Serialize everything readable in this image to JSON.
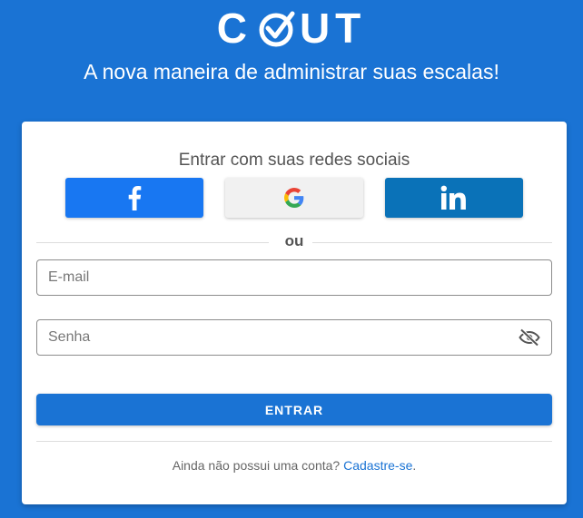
{
  "header": {
    "logo_left": "C",
    "logo_right": "UT",
    "tagline": "A nova maneira de administrar suas escalas!"
  },
  "login": {
    "social_title": "Entrar com suas redes sociais",
    "social_buttons": [
      {
        "name": "facebook",
        "icon": "facebook-icon",
        "color": "#1877f2"
      },
      {
        "name": "google",
        "icon": "google-icon",
        "color": "#f1f1f1"
      },
      {
        "name": "linkedin",
        "icon": "linkedin-icon",
        "color": "#0a72b8"
      }
    ],
    "divider_text": "ou",
    "email": {
      "placeholder": "E-mail",
      "value": ""
    },
    "password": {
      "placeholder": "Senha",
      "value": ""
    },
    "submit_label": "ENTRAR",
    "signup_prompt": "Ainda não possui uma conta?",
    "signup_link": "Cadastre-se",
    "signup_suffix": "."
  },
  "colors": {
    "brand": "#1a73d4",
    "link": "#1a73d4"
  }
}
